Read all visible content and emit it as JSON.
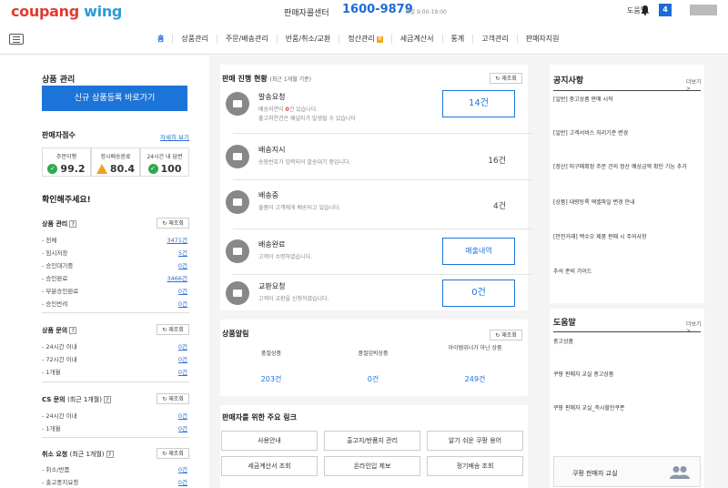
{
  "header": {
    "logo_part1": "coupang",
    "logo_part2": "wing",
    "center_label": "판매자콜센터",
    "center_phone": "1600-9879",
    "center_hours": "평일 9:00-19:00",
    "help": "도움말",
    "notif_count": "4"
  },
  "nav": {
    "items": [
      "홈",
      "상품관리",
      "주문/배송관리",
      "반품/취소/교환",
      "정산관리",
      "세금계산서",
      "통계",
      "고객관리",
      "판매자지원"
    ],
    "badge": "N"
  },
  "left": {
    "product_mgmt_title": "상품 관리",
    "register_cta": "신규 상품등록 바로가기",
    "score_title": "판매자점수",
    "score_detail": "자세히 보기",
    "scores": [
      {
        "label": "주문이행",
        "value": "99.2",
        "status": "ok"
      },
      {
        "label": "정시배송완료",
        "value": "80.4",
        "status": "warn"
      },
      {
        "label": "24시간 내 답변",
        "value": "100",
        "status": "ok"
      }
    ],
    "check_title": "확인해주세요!",
    "refresh": "재조회",
    "product_section": "상품 관리",
    "product_rows": [
      {
        "label": "- 전체",
        "value": "3471건"
      },
      {
        "label": "- 임시저장",
        "value": "5건"
      },
      {
        "label": "- 승인대기중",
        "value": "0건"
      },
      {
        "label": "- 승인완료",
        "value": "3466건"
      },
      {
        "label": "- 부분승인완료",
        "value": "0건"
      },
      {
        "label": "- 승인반려",
        "value": "0건"
      }
    ],
    "inquiry_section": "상품 문의",
    "inquiry_rows": [
      {
        "label": "- 24시간 이내",
        "value": "0건"
      },
      {
        "label": "- 72시간 이내",
        "value": "0건"
      },
      {
        "label": "- 1개월",
        "value": "0건"
      }
    ],
    "cs_section": "CS 문의",
    "cs_sub": "(최근 1개월)",
    "cs_rows": [
      {
        "label": "- 24시간 이내",
        "value": "0건"
      },
      {
        "label": "- 1개월",
        "value": "0건"
      }
    ],
    "cancel_section": "취소 요청",
    "cancel_sub": "(최근 1개월)",
    "cancel_rows": [
      {
        "label": "- 취소/반품",
        "value": "0건"
      },
      {
        "label": "- 출고중지요청",
        "value": "0건"
      }
    ]
  },
  "main": {
    "status_title": "판매 진행 현황",
    "status_sub": "(최근 1개월 기준)",
    "refresh": "재조회",
    "stages": [
      {
        "title": "발송요청",
        "desc_pre": "배송지연이 ",
        "desc_red": "0",
        "desc_post": "건 있습니다.",
        "desc2": "출고지연건은 패널티가 발생될 수 있습니다",
        "count": "14건",
        "icon": "megaphone-icon"
      },
      {
        "title": "배송지시",
        "desc": "송장번호가 입력되어 발송대기 중입니다.",
        "count": "16건",
        "icon": "truck-icon"
      },
      {
        "title": "배송중",
        "desc": "물품이 고객에게 배송되고 있습니다.",
        "count": "4건",
        "icon": "delivery-icon"
      },
      {
        "title": "배송완료",
        "desc": "고객이 수령하였습니다.",
        "button": "매출내역",
        "icon": "box-icon"
      },
      {
        "title": "교환요청",
        "desc": "고객이 교환을 신청하였습니다.",
        "count": "0건",
        "icon": "exchange-icon"
      }
    ],
    "alert_title": "상품알림",
    "alerts": [
      {
        "label": "품절상품",
        "value": "203건"
      },
      {
        "label": "품절임박상품",
        "value": "0건"
      },
      {
        "label": "아이템위너가 아닌 상품",
        "value": "249건"
      }
    ],
    "links_title": "판매자를 위한 주요 링크",
    "links": [
      "사용안내",
      "출고지/반품지 관리",
      "알기 쉬운 쿠팡 용어",
      "세금계산서 조회",
      "온라인입 제보",
      "정기배송 조회"
    ]
  },
  "right": {
    "notice_title": "공지사항",
    "more": "더보기 >",
    "notices": [
      "[일반] 중고상품 판매 시작",
      "[일반] 고객서비스 처리기준 변경",
      "[정산] 미구매확정 주문 건의 정산 예상금액 확인 기능 추가",
      "[상품] 대량등록 엑셀파일 변경 안내",
      "[안전거래] 백수오 제품 판매 시 주의사항",
      "추석 준비 가이드"
    ],
    "help_title": "도움말",
    "help_items": [
      "중고상품",
      "쿠팡 판매자 교실 중고상품",
      "쿠팡 판매자 교실_즉시할인쿠폰"
    ],
    "school": "쿠팡 판매자 교실"
  }
}
